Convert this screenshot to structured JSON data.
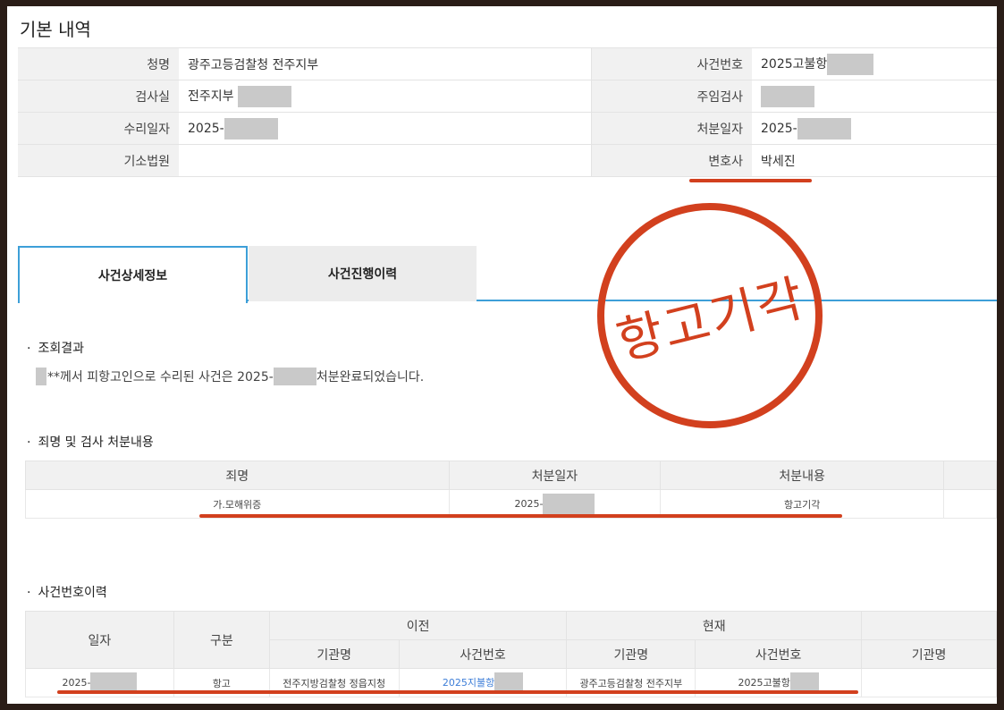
{
  "title": "기본 내역",
  "basic": {
    "rows": [
      {
        "l1": "청명",
        "v1": "광주고등검찰청 전주지부",
        "l2": "사건번호",
        "v2": "2025고불항"
      },
      {
        "l1": "검사실",
        "v1": "전주지부",
        "l2": "주임검사",
        "v2": ""
      },
      {
        "l1": "수리일자",
        "v1": "2025-",
        "l2": "처분일자",
        "v2": "2025-"
      },
      {
        "l1": "기소법원",
        "v1": "",
        "l2": "변호사",
        "v2": "박세진"
      }
    ]
  },
  "tabs": {
    "active": "사건상세정보",
    "inactive": "사건진행이력"
  },
  "stamp": {
    "text": "항고기각",
    "color": "#d2401e"
  },
  "result": {
    "heading": "조회결과",
    "pre": "**께서 피항고인으로 수리된 사건은 2025-",
    "post": "처분완료되었습니다."
  },
  "disposition": {
    "heading": "죄명 및 검사 처분내용",
    "headers": [
      "죄명",
      "처분일자",
      "처분내용"
    ],
    "row": {
      "crime": "가.모해위증",
      "date": "2025-",
      "content": "항고기각"
    }
  },
  "history": {
    "heading": "사건번호이력",
    "h_date": "일자",
    "h_type": "구분",
    "h_prev": "이전",
    "h_curr": "현재",
    "h_org": "기관명",
    "h_case": "사건번호",
    "row": {
      "date": "2025-",
      "type": "항고",
      "prev_org": "전주지방검찰청 정읍지청",
      "prev_case": "2025지불항",
      "curr_org": "광주고등검찰청 전주지부",
      "curr_case": "2025고불항"
    }
  },
  "accent": "#3d9fd8"
}
